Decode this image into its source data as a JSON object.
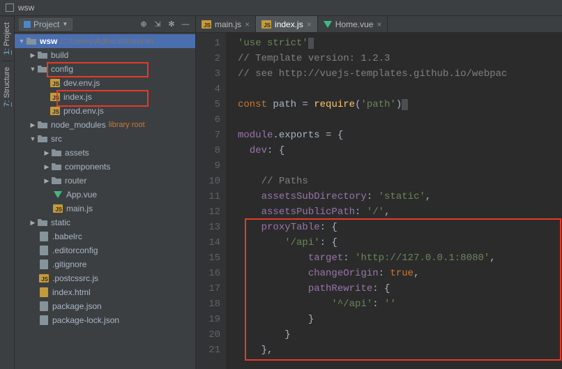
{
  "window": {
    "title": "wsw"
  },
  "gutter_tabs": [
    {
      "num": "1",
      "label": "Project"
    },
    {
      "num": "7",
      "label": "Structure"
    }
  ],
  "project_panel": {
    "title": "Project",
    "root": {
      "name": "wsw",
      "path": "C:\\Users\\Administrator\\m"
    },
    "tree": {
      "build": "build",
      "config": "config",
      "dev_env": "dev.env.js",
      "index_js": "index.js",
      "prod_env": "prod.env.js",
      "node_modules": "node_modules",
      "lib_root": "library root",
      "src": "src",
      "assets": "assets",
      "components": "components",
      "router": "router",
      "app_vue": "App.vue",
      "main_js": "main.js",
      "static": "static",
      "babelrc": ".babelrc",
      "editorconfig": ".editorconfig",
      "gitignore": ".gitignore",
      "postcssrc": ".postcssrc.js",
      "index_html": "index.html",
      "package_json": "package.json",
      "package_lock": "package-lock.json"
    }
  },
  "tabs": [
    {
      "label": "main.js",
      "type": "js"
    },
    {
      "label": "index.js",
      "type": "js",
      "active": true
    },
    {
      "label": "Home.vue",
      "type": "vue"
    }
  ],
  "code": {
    "line1_str": "'use strict'",
    "line2_cmt": "// Template version: 1.2.3",
    "line3_cmt": "// see http://vuejs-templates.github.io/webpac",
    "line5_const": "const",
    "line5_path": " path ",
    "line5_eq": "= ",
    "line5_req": "require",
    "line5_arg": "'path'",
    "line7_mod": "module",
    "line7_exp": ".exports = {",
    "line8_dev": "dev",
    "line8_col": ": {",
    "line10_cmt": "// Paths",
    "line11_k": "assetsSubDirectory",
    "line11_v": "'static'",
    "line12_k": "assetsPublicPath",
    "line12_v": "'/'",
    "line13_k": "proxyTable",
    "line13_v": ": {",
    "line14_k": "'/api'",
    "line14_v": ": {",
    "line15_k": "target",
    "line15_v": "'http://127.0.0.1:8080'",
    "line16_k": "changeOrigin",
    "line16_v": "true",
    "line17_k": "pathRewrite",
    "line17_v": ": {",
    "line18_k": "'^/api'",
    "line18_v": "''",
    "line19": "}",
    "line20": "}",
    "line21": "},"
  },
  "line_numbers": [
    "1",
    "2",
    "3",
    "4",
    "5",
    "6",
    "7",
    "8",
    "9",
    "10",
    "11",
    "12",
    "13",
    "14",
    "15",
    "16",
    "17",
    "18",
    "19",
    "20",
    "21"
  ]
}
